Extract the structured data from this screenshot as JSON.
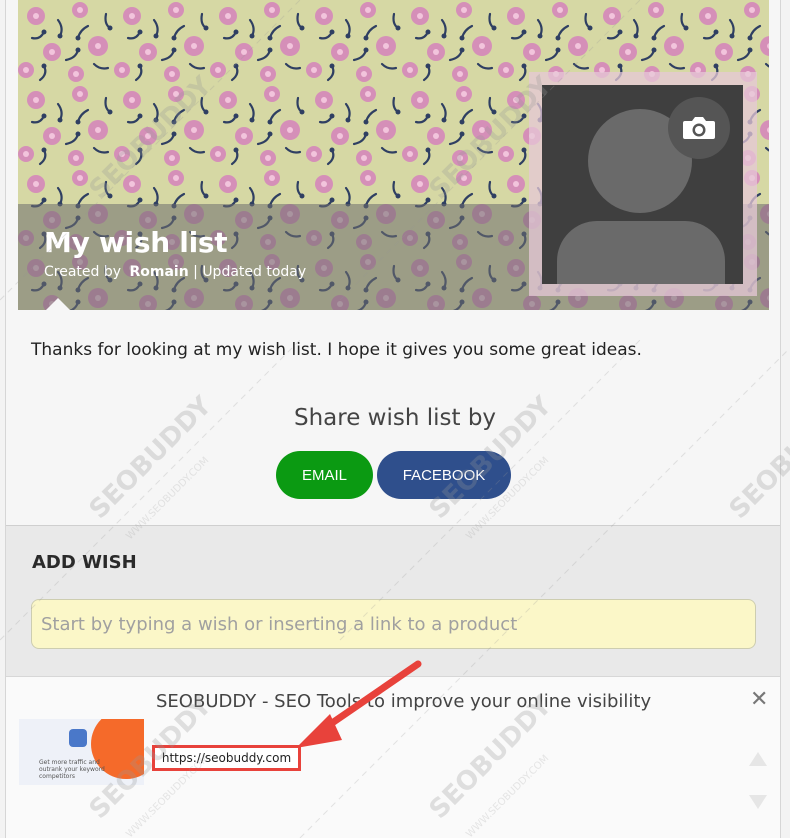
{
  "header": {
    "title": "My wish list",
    "created_by_label": "Created by",
    "author": "Romain",
    "separator": "|",
    "updated": "Updated today",
    "avatar_icon": "person-silhouette-icon",
    "camera_icon": "camera-icon"
  },
  "intro_text": "Thanks for looking at my wish list. I hope it gives you some great ideas.",
  "share": {
    "title": "Share wish list by",
    "email_label": "EMAIL",
    "facebook_label": "FACEBOOK"
  },
  "add_wish": {
    "title": "ADD WISH",
    "placeholder": "Start by typing a wish or inserting a link to a product"
  },
  "link_preview": {
    "title": "SEOBUDDY - SEO Tools to improve your online visibility",
    "url": "https://seobuddy.com",
    "close_icon": "close-icon",
    "thumbnail_text": "Get more traffic and outrank your keyword competitors"
  },
  "watermark": "SEOBUDDY",
  "watermark_sub": "WWW.SEOBUDDY.COM",
  "colors": {
    "email_button": "#0b9a12",
    "facebook_button": "#2f4f8c",
    "input_background": "#fbf7c8",
    "highlight_red": "#e8423b"
  }
}
